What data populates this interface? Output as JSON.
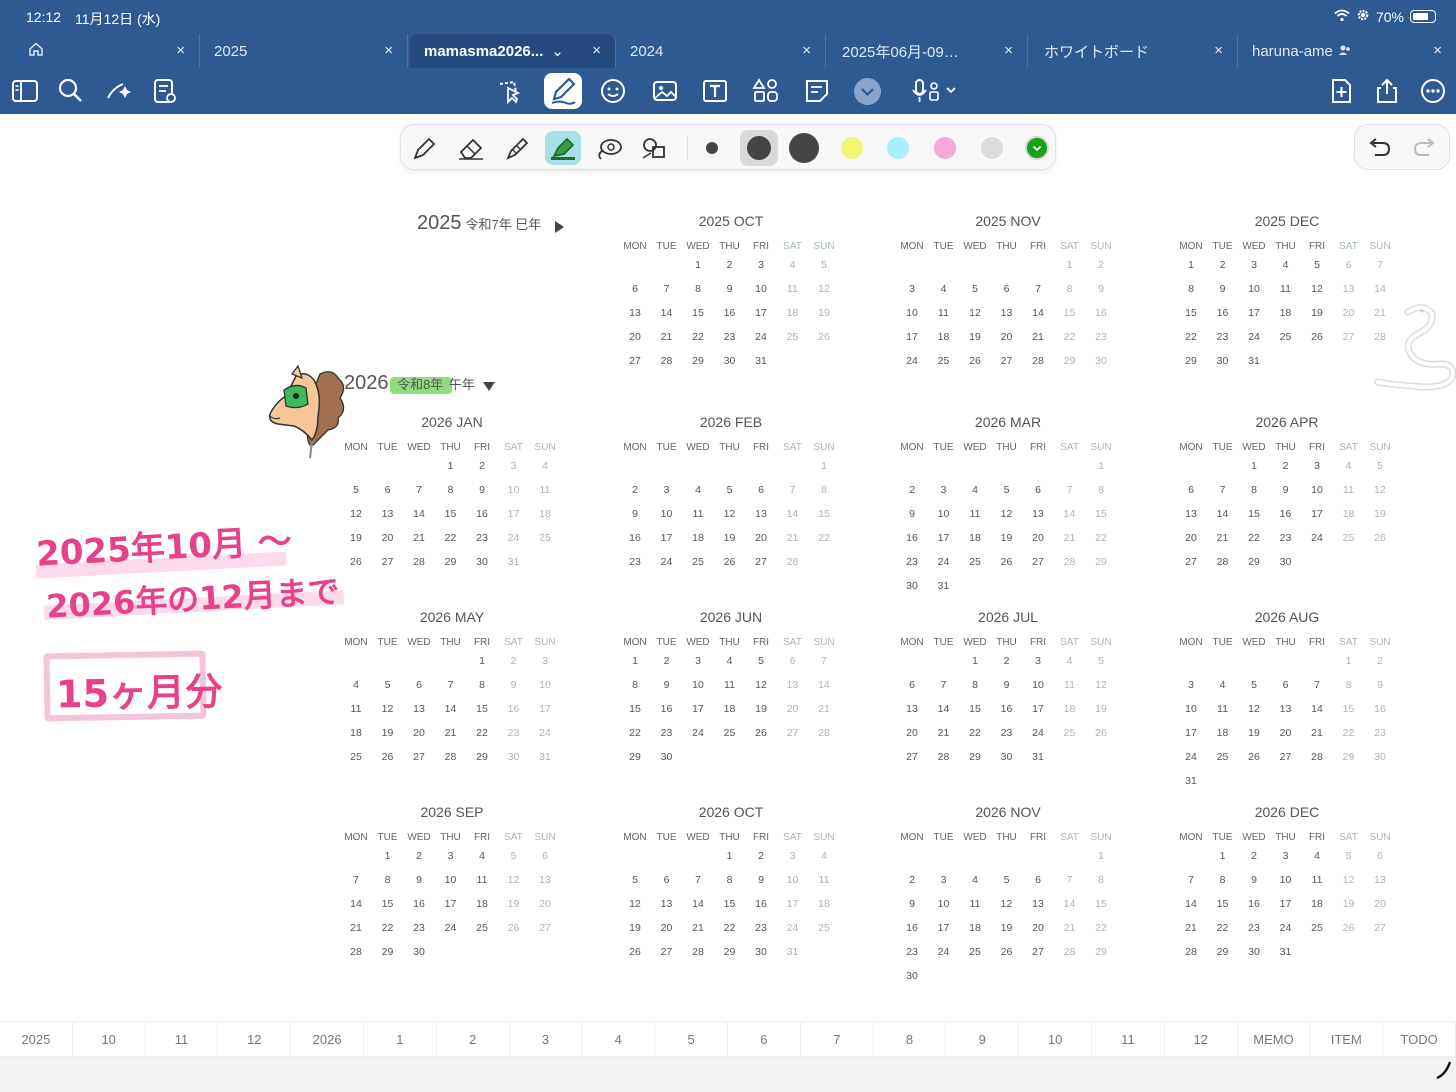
{
  "status": {
    "time": "12:12",
    "date": "11月12日 (水)",
    "battery": "70%"
  },
  "tabs": [
    {
      "label": "",
      "active": false
    },
    {
      "label": "2025",
      "active": false
    },
    {
      "label": "mamasma2026...",
      "active": true
    },
    {
      "label": "2024",
      "active": false
    },
    {
      "label": "2025年06月-09…",
      "active": false
    },
    {
      "label": "ホワイトボード",
      "active": false
    },
    {
      "label": "haruna-ame",
      "active": false
    }
  ],
  "toolbar_icons": [
    "sidebar-icon",
    "search-icon",
    "ai-sparkle-icon",
    "document-icon",
    "lasso-icon",
    "pen-icon",
    "sticker-icon",
    "image-icon",
    "textbox-icon",
    "shapes-icon",
    "note-icon",
    "chevron-down-icon",
    "mic-icon",
    "add-page-icon",
    "share-icon",
    "more-icon"
  ],
  "pen_tools": [
    "pen-tool",
    "eraser-tool",
    "highlighter-tool",
    "highlighter-active-tool",
    "lasso-tool",
    "shape-tool"
  ],
  "colors": {
    "accent": "#2e5a94",
    "highlight_green": "#7fd36d",
    "handwriting_pink": "#e8408a",
    "weekend_gray": "#a8b8b0"
  },
  "swatches": [
    "#444444",
    "#444444",
    "#444444",
    "#f4f478",
    "#aaeef8",
    "#f7a8d6",
    "#dddddd",
    "#1aa11a"
  ],
  "year2025": {
    "year": "2025",
    "sub": "令和7年 巳年"
  },
  "year2026": {
    "year": "2026",
    "sub_era": "令和8年",
    "sub_zodiac": "午年"
  },
  "weekdays": [
    "MON",
    "TUE",
    "WED",
    "THU",
    "FRI",
    "SAT",
    "SUN"
  ],
  "months": [
    {
      "title": "2025 OCT",
      "start": 2,
      "days": 31
    },
    {
      "title": "2025 NOV",
      "start": 5,
      "days": 30
    },
    {
      "title": "2025 DEC",
      "start": 0,
      "days": 31
    },
    {
      "title": "2026 JAN",
      "start": 3,
      "days": 31
    },
    {
      "title": "2026 FEB",
      "start": 6,
      "days": 28
    },
    {
      "title": "2026 MAR",
      "start": 6,
      "days": 31
    },
    {
      "title": "2026 APR",
      "start": 2,
      "days": 30
    },
    {
      "title": "2026 MAY",
      "start": 4,
      "days": 31
    },
    {
      "title": "2026 JUN",
      "start": 0,
      "days": 30
    },
    {
      "title": "2026 JUL",
      "start": 2,
      "days": 31
    },
    {
      "title": "2026 AUG",
      "start": 5,
      "days": 31
    },
    {
      "title": "2026 SEP",
      "start": 1,
      "days": 30
    },
    {
      "title": "2026 OCT",
      "start": 3,
      "days": 31
    },
    {
      "title": "2026 NOV",
      "start": 6,
      "days": 30
    },
    {
      "title": "2026 DEC",
      "start": 1,
      "days": 31
    }
  ],
  "handwriting": {
    "line1": "2025年10月 〜",
    "line2": "2026年の12月まで",
    "line3": "15ヶ月分"
  },
  "bottom_tabs": [
    "2025",
    "10",
    "11",
    "12",
    "2026",
    "1",
    "2",
    "3",
    "4",
    "5",
    "6",
    "7",
    "8",
    "9",
    "10",
    "11",
    "12",
    "MEMO",
    "ITEM",
    "TODO"
  ]
}
